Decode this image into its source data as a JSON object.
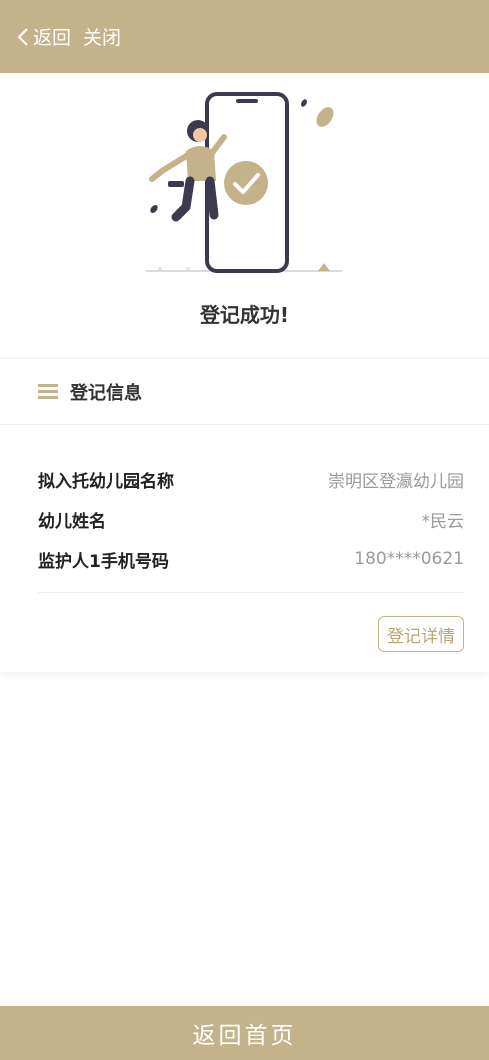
{
  "header": {
    "back_label": "返回",
    "close_label": "关闭"
  },
  "result": {
    "message": "登记成功!"
  },
  "card": {
    "title": "登记信息",
    "rows": [
      {
        "label": "拟入托幼儿园名称",
        "value": "崇明区登瀛幼儿园"
      },
      {
        "label": "幼儿姓名",
        "value": "*民云"
      },
      {
        "label": "监护人1手机号码",
        "value": "180****0621"
      }
    ],
    "detail_button": "登记详情"
  },
  "footer": {
    "home_button": "返回首页"
  },
  "colors": {
    "accent": "#c4b38a",
    "success": "#c4b38a"
  }
}
